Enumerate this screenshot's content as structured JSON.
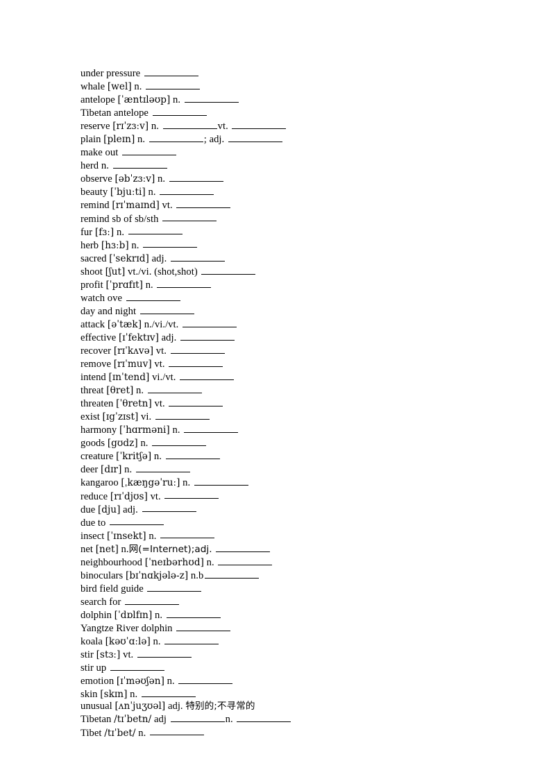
{
  "document": {
    "type": "vocabulary-worksheet",
    "language_pair": "English-Chinese",
    "blank_label": "fill-in-blank",
    "page_background": "#ffffff",
    "text_color": "#000000"
  },
  "entries": [
    {
      "term": "under pressure",
      "phonetic": "",
      "pos": "",
      "blanks": 1,
      "note": ""
    },
    {
      "term": "whale",
      "phonetic": "[wel]",
      "pos": "n.",
      "blanks": 1,
      "note": ""
    },
    {
      "term": "antelope",
      "phonetic": "[ˈæntɪləʊp]",
      "pos": "n.",
      "blanks": 1,
      "note": ""
    },
    {
      "term": "Tibetan antelope",
      "phonetic": "",
      "pos": "",
      "blanks": 1,
      "note": ""
    },
    {
      "term": "reserve",
      "phonetic": "[rɪˈzɜːv]",
      "pos": "n.",
      "blanks": 2,
      "second_pos": "vt.",
      "note": ""
    },
    {
      "term": "plain",
      "phonetic": "[pleɪn]",
      "pos": "n.",
      "blanks": 2,
      "second_pos": "adj.",
      "separator": ";",
      "note": ""
    },
    {
      "term": "make out",
      "phonetic": "",
      "pos": "",
      "blanks": 1,
      "note": ""
    },
    {
      "term": "herd",
      "phonetic": "",
      "pos": "n.",
      "blanks": 1,
      "note": ""
    },
    {
      "term": "observe",
      "phonetic": "[əbˈzɜːv]",
      "pos": "n.",
      "blanks": 1,
      "note": ""
    },
    {
      "term": "beauty",
      "phonetic": "[ˈbjuːti]",
      "pos": "n.",
      "blanks": 1,
      "note": ""
    },
    {
      "term": "remind",
      "phonetic": "[rɪˈmaɪnd]",
      "pos": "vt.",
      "blanks": 1,
      "note": ""
    },
    {
      "term": "remind sb of sb/sth",
      "phonetic": "",
      "pos": "",
      "blanks": 1,
      "note": ""
    },
    {
      "term": "fur",
      "phonetic": "[fɜː]",
      "pos": "n.",
      "blanks": 1,
      "note": ""
    },
    {
      "term": "herb",
      "phonetic": "[hɜːb]",
      "pos": "n.",
      "blanks": 1,
      "note": ""
    },
    {
      "term": "sacred",
      "phonetic": "[ˈsekrɪd]",
      "pos": "adj.",
      "blanks": 1,
      "note": ""
    },
    {
      "term": "shoot",
      "phonetic": "[ʃut]",
      "pos": "vt./vi. (shot,shot)",
      "blanks": 1,
      "note": ""
    },
    {
      "term": "profit",
      "phonetic": "[ˈprɑfɪt]",
      "pos": "n.",
      "blanks": 1,
      "note": ""
    },
    {
      "term": "watch ove",
      "phonetic": "",
      "pos": "",
      "blanks": 1,
      "note": ""
    },
    {
      "term": "day and night",
      "phonetic": "",
      "pos": "",
      "blanks": 1,
      "note": ""
    },
    {
      "term": "attack",
      "phonetic": "[əˈtæk]",
      "pos": "n./vi./vt.",
      "blanks": 1,
      "note": ""
    },
    {
      "term": "effective",
      "phonetic": "[ɪˈfektɪv]",
      "pos": "adj.",
      "blanks": 1,
      "note": ""
    },
    {
      "term": "recover",
      "phonetic": "[rɪˈkʌvə]",
      "pos": "vt.",
      "blanks": 1,
      "note": ""
    },
    {
      "term": "remove",
      "phonetic": "[rɪˈmuv]",
      "pos": "vt.",
      "blanks": 1,
      "note": ""
    },
    {
      "term": "intend",
      "phonetic": "[ɪnˈtend]",
      "pos": "vi./vt.",
      "blanks": 1,
      "note": ""
    },
    {
      "term": "threat",
      "phonetic": "[θret]",
      "pos": "n.",
      "blanks": 1,
      "note": ""
    },
    {
      "term": "threaten",
      "phonetic": "[ˈθretn]",
      "pos": "vt.",
      "blanks": 1,
      "note": ""
    },
    {
      "term": "exist",
      "phonetic": "[ɪgˈzɪst]",
      "pos": "vi.",
      "blanks": 1,
      "note": ""
    },
    {
      "term": "harmony",
      "phonetic": "[ˈhɑrməni]",
      "pos": "n.",
      "blanks": 1,
      "note": ""
    },
    {
      "term": "goods",
      "phonetic": "[gʊdz]",
      "pos": "n.",
      "blanks": 1,
      "note": ""
    },
    {
      "term": "creature",
      "phonetic": "[ˈkritʃə]",
      "pos": "n.",
      "blanks": 1,
      "note": ""
    },
    {
      "term": "deer",
      "phonetic": "[dɪr]",
      "pos": "n.",
      "blanks": 1,
      "note": ""
    },
    {
      "term": "kangaroo",
      "phonetic": "[ˌkæŋgəˈruː]",
      "pos": "n.",
      "blanks": 1,
      "note": ""
    },
    {
      "term": "reduce",
      "phonetic": "[rɪˈdjʊs]",
      "pos": "vt.",
      "blanks": 1,
      "note": ""
    },
    {
      "term": "due",
      "phonetic": "[dju]",
      "pos": "adj.",
      "blanks": 1,
      "note": ""
    },
    {
      "term": "due to",
      "phonetic": "",
      "pos": "",
      "blanks": 1,
      "note": ""
    },
    {
      "term": "insect",
      "phonetic": "[ˈɪnsekt]",
      "pos": "n.",
      "blanks": 1,
      "note": ""
    },
    {
      "term": "net",
      "phonetic": "[net]",
      "pos": "n.",
      "inline_note": "网(=Internet);adj.",
      "blanks": 1,
      "note": ""
    },
    {
      "term": "neighbourhood",
      "phonetic": "[ˈneɪbərhʊd]",
      "pos": "n.",
      "blanks": 1,
      "note": ""
    },
    {
      "term": "binoculars",
      "phonetic": "[bɪˈnɑkjələ-z]",
      "pos": "n.b",
      "blanks": 1,
      "no_space_before_blank": true,
      "note": ""
    },
    {
      "term": "bird field guide",
      "phonetic": "",
      "pos": "",
      "blanks": 1,
      "note": ""
    },
    {
      "term": "search for",
      "phonetic": "",
      "pos": "",
      "blanks": 1,
      "note": ""
    },
    {
      "term": "dolphin",
      "phonetic": "[ˈdɒlfɪn]",
      "pos": "n.",
      "blanks": 1,
      "note": ""
    },
    {
      "term": "Yangtze River dolphin",
      "phonetic": "",
      "pos": "",
      "blanks": 1,
      "note": ""
    },
    {
      "term": "koala",
      "phonetic": "[kəʊˈɑːlə]",
      "pos": "n.",
      "blanks": 1,
      "note": ""
    },
    {
      "term": "stir",
      "phonetic": "[stɜː]",
      "pos": "vt.",
      "blanks": 1,
      "note": ""
    },
    {
      "term": "stir up",
      "phonetic": "",
      "pos": "",
      "blanks": 1,
      "note": ""
    },
    {
      "term": "emotion",
      "phonetic": "[ɪˈməʊʃən]",
      "pos": "n.",
      "blanks": 1,
      "note": ""
    },
    {
      "term": "skin",
      "phonetic": "[skɪn]",
      "pos": "n.",
      "blanks": 1,
      "note": ""
    },
    {
      "term": "unusual",
      "phonetic": "[ʌnˈjuʒʊəl]",
      "pos": "adj.",
      "blanks": 0,
      "answer_cn": "特别的;不寻常的",
      "note": ""
    },
    {
      "term": "Tibetan",
      "phonetic": "/tɪˈbetn/",
      "pos": "adj",
      "blanks": 2,
      "second_pos": "n.",
      "note": ""
    },
    {
      "term": "Tibet",
      "phonetic": "/tɪˈbet/",
      "pos": "n.",
      "blanks": 1,
      "note": ""
    }
  ]
}
